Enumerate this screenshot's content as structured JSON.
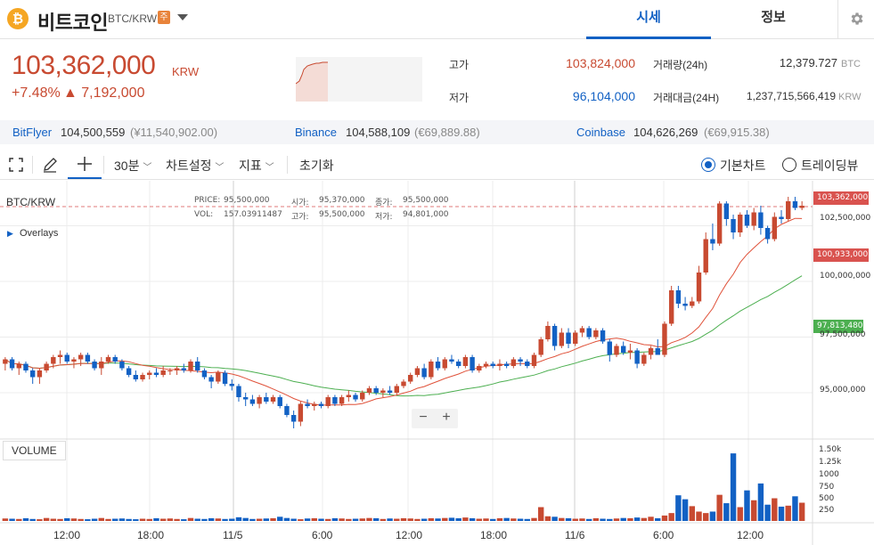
{
  "header": {
    "coin_symbol": "₿",
    "coin_name": "비트코인",
    "pair": "BTC/KRW",
    "badge": "주",
    "tabs": [
      {
        "label": "시세"
      },
      {
        "label": "정보"
      }
    ]
  },
  "summary": {
    "price": "103,362,000",
    "unit": "KRW",
    "change_pct": "+7.48%",
    "change_amt": "▲ 7,192,000",
    "high_label": "고가",
    "high": "103,824,000",
    "low_label": "저가",
    "low": "96,104,000",
    "volume_label": "거래량(24h)",
    "volume": "12,379.727",
    "volume_unit": "BTC",
    "turnover_label": "거래대금(24H)",
    "turnover": "1,237,715,566,419",
    "turnover_unit": "KRW"
  },
  "exchanges": [
    {
      "name": "BitFlyer",
      "price": "104,500,559",
      "fx": "(¥11,540,902.00)"
    },
    {
      "name": "Binance",
      "price": "104,588,109",
      "fx": "(€69,889.88)"
    },
    {
      "name": "Coinbase",
      "price": "104,626,269",
      "fx": "(€69,915.38)"
    }
  ],
  "toolbar": {
    "interval": "30분",
    "chart_settings": "차트설정",
    "indicators": "지표",
    "reset": "초기화",
    "basic_chart": "기본차트",
    "tradingview": "트레이딩뷰"
  },
  "chart": {
    "pair_label": "BTC/KRW",
    "overlays": "Overlays",
    "ohlc": {
      "price_label": "PRICE:",
      "price": "95,500,000",
      "open_label": "시가:",
      "open": "95,370,000",
      "close_label": "종가:",
      "close": "95,500,000",
      "vol_label": "VOL:",
      "vol": "157.03911487",
      "high_label": "고가:",
      "high": "95,500,000",
      "low_label": "저가:",
      "low": "94,801,000"
    },
    "zoom_out": "−",
    "zoom_in": "+",
    "volume_label": "VOLUME",
    "tag_current": "103,362,000",
    "tag_ma_short": "100,933,000",
    "tag_ma_long": "97,813,480",
    "colors": {
      "up": "#c84a31",
      "down": "#1261c4",
      "ma_short": "#e0523a",
      "ma_long": "#4caf50"
    }
  },
  "chart_data": {
    "type": "candlestick",
    "y_ticks": [
      "102,500,000",
      "100,000,000",
      "97,500,000",
      "95,000,000"
    ],
    "volume_ticks": [
      "1.50k",
      "1.25k",
      "1000",
      "750",
      "500",
      "250"
    ],
    "x_ticks": [
      "12:00",
      "18:00",
      "11/5",
      "6:00",
      "12:00",
      "18:00",
      "11/6",
      "6:00",
      "12:00"
    ],
    "ylim": [
      93000000,
      104200000
    ],
    "vol_lim": [
      0,
      1625
    ],
    "candles": [
      [
        96.3,
        96.6,
        96.0,
        96.5
      ],
      [
        96.5,
        96.6,
        96.0,
        96.1
      ],
      [
        96.1,
        96.4,
        95.8,
        96.3
      ],
      [
        96.3,
        96.4,
        95.9,
        96.0
      ],
      [
        96.0,
        96.1,
        95.4,
        95.7
      ],
      [
        95.7,
        96.1,
        95.4,
        96.0
      ],
      [
        96.0,
        96.4,
        95.9,
        96.3
      ],
      [
        96.3,
        96.7,
        96.1,
        96.6
      ],
      [
        96.6,
        96.9,
        96.3,
        96.7
      ],
      [
        96.7,
        96.8,
        96.3,
        96.4
      ],
      [
        96.4,
        96.6,
        96.1,
        96.5
      ],
      [
        96.5,
        96.8,
        96.2,
        96.7
      ],
      [
        96.7,
        96.8,
        96.3,
        96.4
      ],
      [
        96.4,
        96.5,
        96.0,
        96.1
      ],
      [
        96.1,
        96.6,
        95.8,
        96.4
      ],
      [
        96.4,
        96.7,
        96.3,
        96.6
      ],
      [
        96.6,
        96.7,
        96.3,
        96.4
      ],
      [
        96.4,
        96.5,
        96.0,
        96.1
      ],
      [
        96.1,
        96.2,
        95.7,
        95.8
      ],
      [
        95.8,
        96.0,
        95.5,
        95.6
      ],
      [
        95.6,
        95.9,
        95.5,
        95.8
      ],
      [
        95.8,
        96.0,
        95.6,
        95.9
      ],
      [
        95.9,
        96.1,
        95.7,
        95.8
      ],
      [
        95.8,
        96.2,
        95.7,
        96.0
      ],
      [
        96.0,
        96.1,
        95.8,
        96.0
      ],
      [
        96.0,
        96.2,
        95.8,
        96.1
      ],
      [
        96.1,
        96.3,
        95.9,
        96.0
      ],
      [
        96.0,
        96.5,
        95.9,
        96.4
      ],
      [
        96.4,
        96.6,
        95.9,
        96.0
      ],
      [
        96.0,
        96.1,
        95.6,
        95.7
      ],
      [
        95.7,
        95.8,
        95.2,
        95.5
      ],
      [
        95.5,
        96.0,
        95.4,
        95.9
      ],
      [
        95.9,
        96.0,
        95.3,
        95.4
      ],
      [
        95.4,
        95.6,
        95.1,
        95.3
      ],
      [
        95.3,
        95.4,
        94.6,
        94.8
      ],
      [
        94.8,
        95.0,
        94.4,
        94.7
      ],
      [
        94.7,
        94.9,
        94.4,
        94.5
      ],
      [
        94.5,
        94.9,
        94.3,
        94.8
      ],
      [
        94.8,
        95.0,
        94.5,
        94.6
      ],
      [
        94.6,
        94.9,
        94.5,
        94.8
      ],
      [
        94.8,
        94.9,
        94.3,
        94.4
      ],
      [
        94.4,
        94.5,
        93.9,
        94.0
      ],
      [
        94.0,
        94.2,
        93.4,
        93.7
      ],
      [
        93.7,
        94.6,
        93.5,
        94.5
      ],
      [
        94.5,
        94.7,
        94.3,
        94.4
      ],
      [
        94.4,
        94.6,
        94.2,
        94.5
      ],
      [
        94.5,
        94.6,
        94.3,
        94.4
      ],
      [
        94.4,
        94.9,
        94.3,
        94.8
      ],
      [
        94.8,
        94.9,
        94.4,
        94.5
      ],
      [
        94.5,
        94.9,
        94.4,
        94.8
      ],
      [
        94.8,
        95.1,
        94.6,
        94.9
      ],
      [
        94.9,
        95.0,
        94.6,
        94.7
      ],
      [
        94.7,
        95.1,
        94.6,
        95.0
      ],
      [
        95.0,
        95.3,
        94.9,
        95.2
      ],
      [
        95.2,
        95.3,
        94.9,
        95.0
      ],
      [
        95.0,
        95.2,
        94.8,
        95.1
      ],
      [
        95.1,
        95.3,
        94.9,
        95.0
      ],
      [
        95.0,
        95.4,
        94.9,
        95.3
      ],
      [
        95.3,
        95.6,
        95.2,
        95.5
      ],
      [
        95.5,
        95.9,
        95.4,
        95.8
      ],
      [
        95.8,
        96.2,
        95.7,
        96.1
      ],
      [
        96.1,
        96.3,
        95.6,
        95.7
      ],
      [
        95.7,
        96.5,
        95.6,
        96.4
      ],
      [
        96.4,
        96.6,
        96.0,
        96.1
      ],
      [
        96.1,
        96.6,
        96.0,
        96.5
      ],
      [
        96.5,
        96.7,
        96.3,
        96.4
      ],
      [
        96.4,
        96.5,
        96.1,
        96.2
      ],
      [
        96.2,
        96.7,
        96.1,
        96.6
      ],
      [
        96.6,
        96.7,
        95.9,
        96.0
      ],
      [
        96.0,
        96.3,
        95.9,
        96.2
      ],
      [
        96.2,
        96.4,
        96.1,
        96.3
      ],
      [
        96.3,
        96.4,
        96.1,
        96.2
      ],
      [
        96.2,
        96.5,
        96.0,
        96.3
      ],
      [
        96.3,
        96.4,
        96.1,
        96.2
      ],
      [
        96.2,
        96.6,
        96.1,
        96.5
      ],
      [
        96.5,
        96.6,
        96.2,
        96.4
      ],
      [
        96.4,
        96.5,
        96.1,
        96.2
      ],
      [
        96.2,
        96.8,
        96.1,
        96.7
      ],
      [
        96.7,
        97.5,
        96.6,
        97.4
      ],
      [
        97.4,
        98.2,
        97.3,
        98.0
      ],
      [
        98.0,
        98.1,
        96.9,
        97.1
      ],
      [
        97.1,
        97.9,
        97.0,
        97.7
      ],
      [
        97.7,
        97.9,
        97.0,
        97.2
      ],
      [
        97.2,
        97.8,
        97.1,
        97.7
      ],
      [
        97.7,
        98.0,
        97.5,
        97.9
      ],
      [
        97.9,
        98.0,
        97.4,
        97.5
      ],
      [
        97.5,
        97.9,
        97.4,
        97.8
      ],
      [
        97.8,
        97.9,
        97.2,
        97.3
      ],
      [
        97.3,
        97.4,
        96.4,
        96.7
      ],
      [
        96.7,
        97.2,
        96.6,
        97.1
      ],
      [
        97.1,
        97.3,
        96.7,
        96.8
      ],
      [
        96.8,
        97.2,
        96.5,
        96.9
      ],
      [
        96.9,
        97.0,
        96.1,
        96.3
      ],
      [
        96.3,
        96.8,
        96.2,
        96.7
      ],
      [
        96.7,
        97.1,
        96.5,
        97.0
      ],
      [
        97.0,
        97.4,
        96.8,
        96.7
      ],
      [
        96.7,
        98.2,
        96.6,
        98.1
      ],
      [
        98.1,
        99.8,
        98.0,
        99.6
      ],
      [
        99.6,
        99.8,
        98.8,
        99.0
      ],
      [
        99.0,
        99.3,
        98.7,
        98.9
      ],
      [
        98.9,
        99.3,
        98.8,
        99.1
      ],
      [
        99.1,
        100.7,
        99.0,
        100.4
      ],
      [
        100.4,
        102.2,
        100.3,
        101.9
      ],
      [
        101.9,
        102.6,
        101.4,
        101.7
      ],
      [
        101.7,
        103.6,
        101.6,
        103.5
      ],
      [
        103.5,
        103.6,
        102.5,
        102.8
      ],
      [
        102.8,
        103.0,
        101.9,
        102.2
      ],
      [
        102.2,
        103.1,
        102.0,
        103.0
      ],
      [
        103.0,
        103.2,
        102.4,
        102.5
      ],
      [
        102.5,
        103.3,
        102.3,
        103.1
      ],
      [
        103.1,
        103.4,
        102.1,
        102.4
      ],
      [
        102.4,
        102.5,
        101.7,
        101.9
      ],
      [
        101.9,
        103.1,
        101.8,
        102.9
      ],
      [
        102.9,
        103.2,
        102.6,
        102.8
      ],
      [
        102.8,
        103.8,
        102.7,
        103.6
      ],
      [
        103.6,
        103.8,
        103.2,
        103.3
      ],
      [
        103.3,
        103.6,
        103.2,
        103.4
      ]
    ],
    "volumes": [
      50,
      45,
      40,
      55,
      40,
      35,
      60,
      45,
      40,
      55,
      50,
      40,
      35,
      45,
      60,
      40,
      45,
      50,
      40,
      35,
      45,
      40,
      55,
      45,
      50,
      40,
      35,
      60,
      45,
      40,
      55,
      50,
      40,
      45,
      75,
      60,
      40,
      45,
      50,
      55,
      85,
      60,
      45,
      35,
      50,
      55,
      45,
      40,
      55,
      50,
      40,
      45,
      50,
      60,
      55,
      40,
      50,
      45,
      55,
      50,
      40,
      45,
      55,
      50,
      60,
      65,
      55,
      70,
      55,
      45,
      50,
      40,
      55,
      60,
      50,
      45,
      40,
      60,
      280,
      95,
      85,
      60,
      55,
      45,
      50,
      40,
      55,
      45,
      40,
      50,
      60,
      55,
      70,
      60,
      85,
      55,
      110,
      160,
      520,
      440,
      300,
      190,
      160,
      190,
      530,
      360,
      1370,
      280,
      620,
      420,
      760,
      330,
      460,
      290,
      310,
      500,
      370,
      330,
      120,
      130,
      70
    ]
  }
}
